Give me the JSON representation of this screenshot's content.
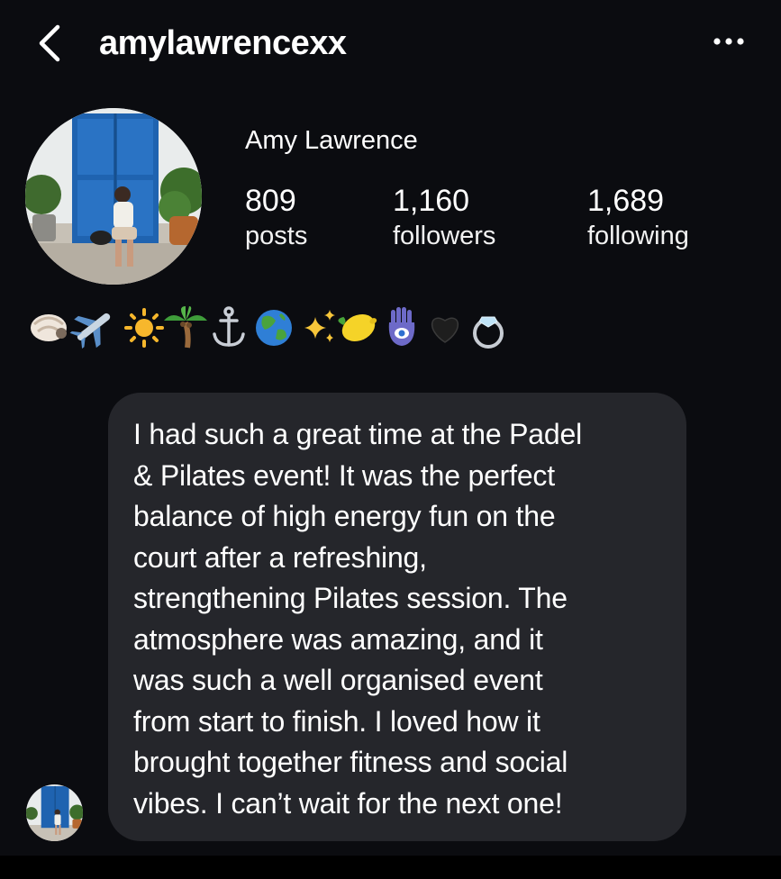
{
  "header": {
    "username": "amylawrencexx",
    "back_icon": "chevron-left-icon",
    "more_icon": "more-horizontal-icon"
  },
  "profile": {
    "display_name": "Amy Lawrence",
    "stats": {
      "posts": {
        "value": "809",
        "label": "posts"
      },
      "followers": {
        "value": "1,160",
        "label": "followers"
      },
      "following": {
        "value": "1,689",
        "label": "following"
      }
    },
    "bio_emojis": [
      "shell",
      "airplane",
      "sun",
      "palm-tree",
      "anchor",
      "globe",
      "sparkles",
      "lemon",
      "hamsa",
      "black-heart",
      "ring"
    ]
  },
  "message": {
    "lines": [
      "I had such a great time at the Padel",
      "& Pilates event! It was the perfect",
      "balance of high energy fun on the",
      "court after a refreshing,",
      "strengthening Pilates session. The",
      "atmosphere was amazing, and it",
      "was such a well organised event",
      "from start to finish. I loved how it",
      "brought together fitness and social",
      "vibes. I can’t wait for the next one!"
    ]
  },
  "colors": {
    "background": "#0b0c10",
    "bubble": "#25262b",
    "text": "#ffffff"
  }
}
